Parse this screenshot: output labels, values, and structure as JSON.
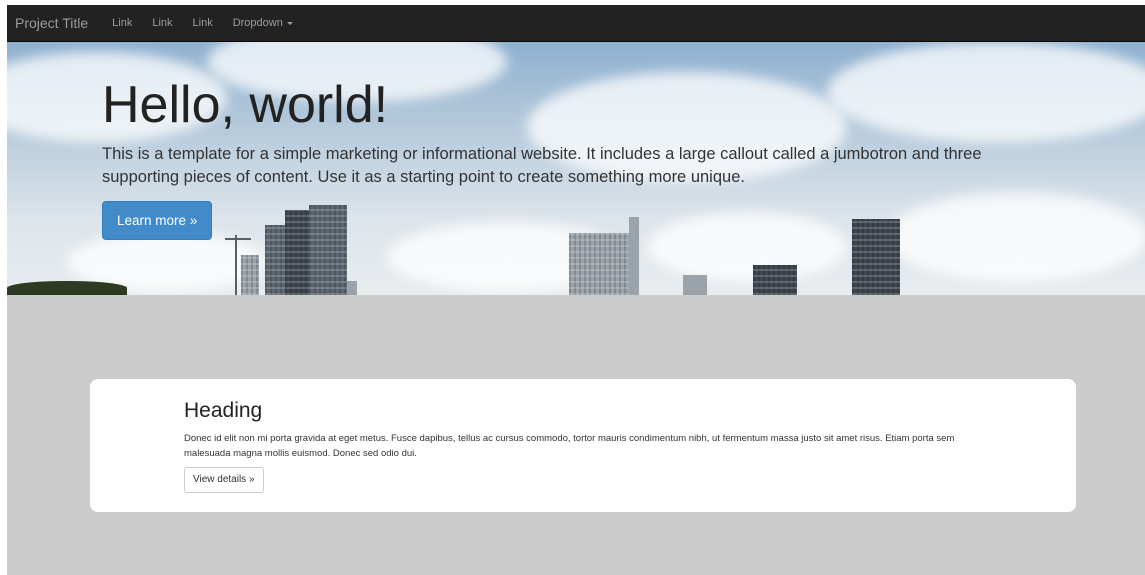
{
  "navbar": {
    "brand": "Project Title",
    "links": [
      "Link",
      "Link",
      "Link"
    ],
    "dropdown": "Dropdown"
  },
  "jumbotron": {
    "title": "Hello, world!",
    "text": "This is a template for a simple marketing or informational website. It includes a large callout called a jumbotron and three supporting pieces of content. Use it as a starting point to create something more unique.",
    "button": "Learn more »"
  },
  "card": {
    "heading": "Heading",
    "text": "Donec id elit non mi porta gravida at eget metus. Fusce dapibus, tellus ac cursus commodo, tortor mauris condimentum nibh, ut fermentum massa justo sit amet risus. Etiam porta sem malesuada magna mollis euismod. Donec sed odio dui.",
    "button": "View details »"
  },
  "icons": {
    "dropdown": "caret-down-icon"
  },
  "colors": {
    "navbar_bg": "#222222",
    "nav_text": "#9d9d9d",
    "primary_button": "#428bca",
    "page_bg": "#cccccc"
  }
}
